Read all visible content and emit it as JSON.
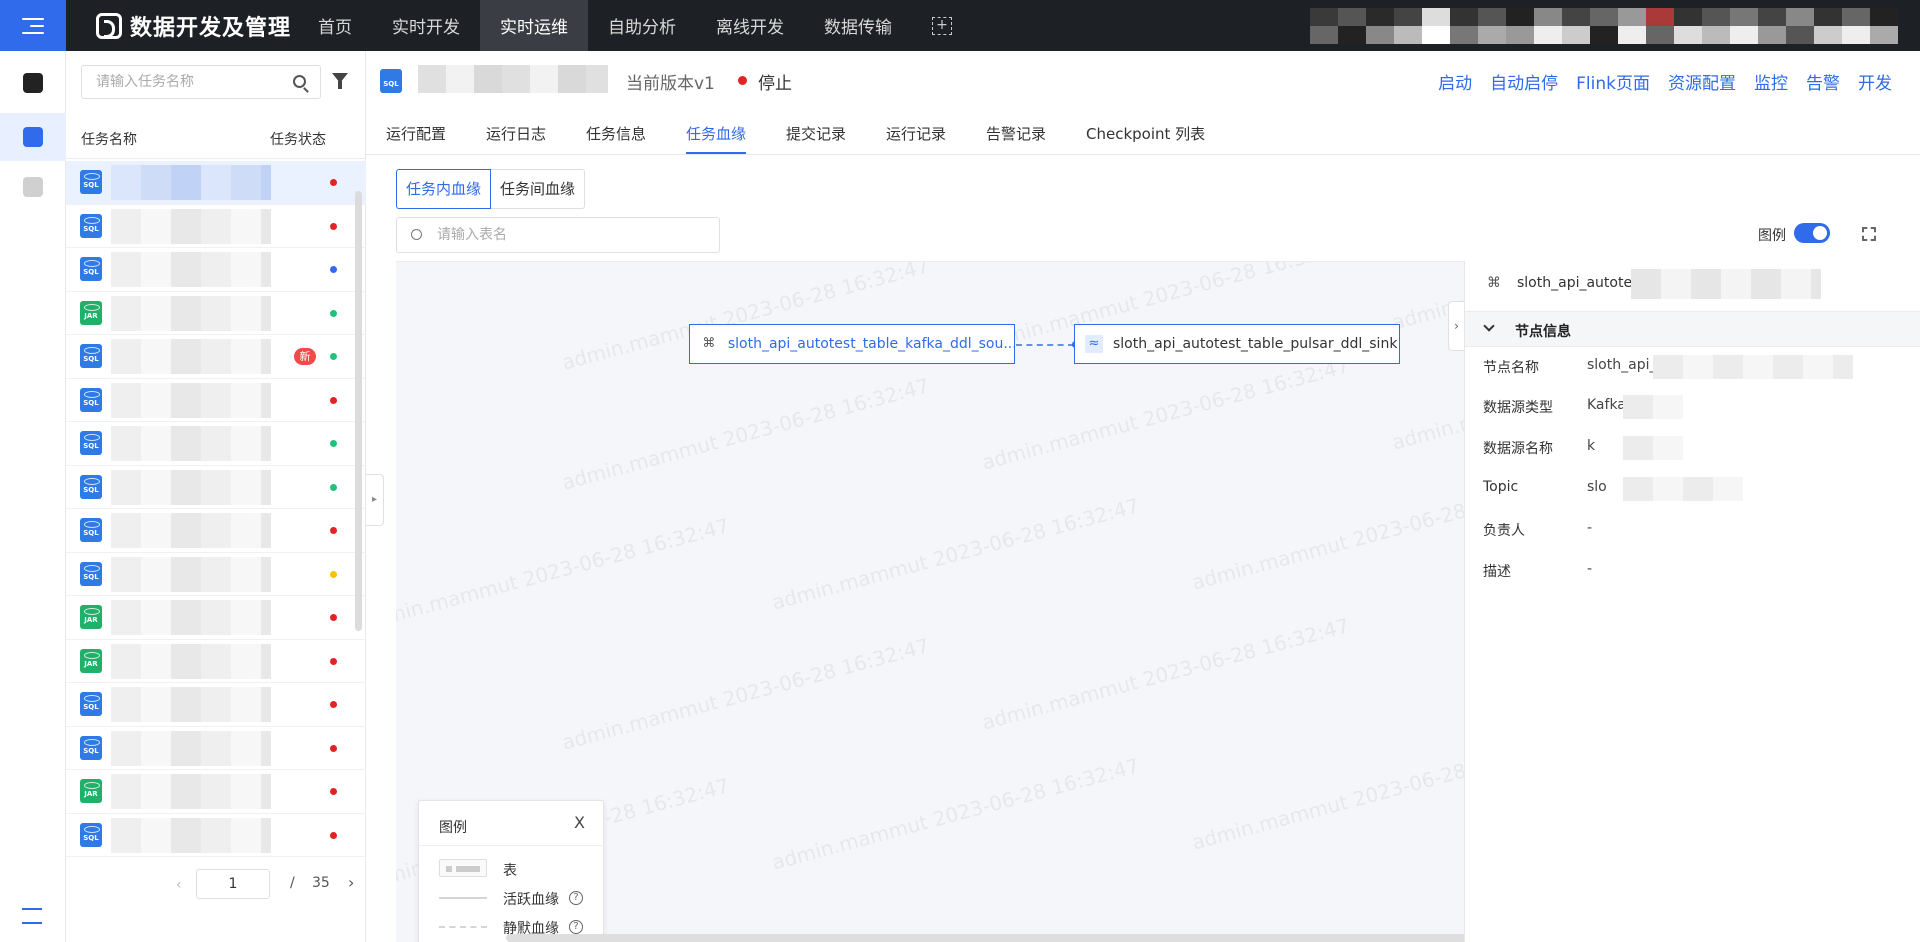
{
  "app": {
    "title": "数据开发及管理"
  },
  "nav": {
    "items": [
      {
        "label": "首页"
      },
      {
        "label": "实时开发"
      },
      {
        "label": "实时运维",
        "active": true
      },
      {
        "label": "自助分析"
      },
      {
        "label": "离线开发"
      },
      {
        "label": "数据传输"
      }
    ]
  },
  "sidebar": {
    "search_placeholder": "请输入任务名称",
    "col_name": "任务名称",
    "col_status": "任务状态",
    "new_tag": "新",
    "rows": [
      {
        "type": "SQL",
        "status": "#e02424",
        "selected": true
      },
      {
        "type": "SQL",
        "status": "#e02424"
      },
      {
        "type": "SQL",
        "status": "#2f6bea"
      },
      {
        "type": "JAR",
        "status": "#22c07a"
      },
      {
        "type": "SQL",
        "status": "#22c07a",
        "new": true
      },
      {
        "type": "SQL",
        "status": "#e02424"
      },
      {
        "type": "SQL",
        "status": "#22c07a"
      },
      {
        "type": "SQL",
        "status": "#22c07a"
      },
      {
        "type": "SQL",
        "status": "#e02424"
      },
      {
        "type": "SQL",
        "status": "#f5c400"
      },
      {
        "type": "JAR",
        "status": "#e02424"
      },
      {
        "type": "JAR",
        "status": "#e02424"
      },
      {
        "type": "SQL",
        "status": "#e02424"
      },
      {
        "type": "SQL",
        "status": "#e02424"
      },
      {
        "type": "JAR",
        "status": "#e02424"
      },
      {
        "type": "SQL",
        "status": "#e02424"
      }
    ],
    "pager": {
      "current": "1",
      "sep": "/",
      "total": "35"
    }
  },
  "task": {
    "type": "SQL",
    "version": "当前版本v1",
    "status": "停止",
    "actions": [
      "启动",
      "自动启停",
      "Flink页面",
      "资源配置",
      "监控",
      "告警",
      "开发"
    ]
  },
  "tabs": [
    {
      "label": "运行配置"
    },
    {
      "label": "运行日志"
    },
    {
      "label": "任务信息"
    },
    {
      "label": "任务血缘",
      "active": true
    },
    {
      "label": "提交记录"
    },
    {
      "label": "运行记录"
    },
    {
      "label": "告警记录"
    },
    {
      "label": "Checkpoint 列表"
    }
  ],
  "lineage": {
    "seg_inner": "任务内血缘",
    "seg_between": "任务间血缘",
    "table_search_placeholder": "请输入表名",
    "legend_label": "图例",
    "source_node": "sloth_api_autotest_table_kafka_ddl_sou...",
    "sink_node": "sloth_api_autotest_table_pulsar_ddl_sink",
    "watermark": "admin.mammut 2023-06-28 16:32:47"
  },
  "legend": {
    "title": "图例",
    "close": "X",
    "table": "表",
    "active": "活跃血缘",
    "silent": "静默血缘"
  },
  "node_info": {
    "title": "sloth_api_autotes",
    "section": "节点信息",
    "fields": [
      {
        "key": "节点名称",
        "value": "sloth_api_"
      },
      {
        "key": "数据源类型",
        "value": "Kafka"
      },
      {
        "key": "数据源名称",
        "value": "k"
      },
      {
        "key": "Topic",
        "value": "slo"
      },
      {
        "key": "负责人",
        "value": "-"
      },
      {
        "key": "描述",
        "value": "-"
      }
    ]
  },
  "colors": {
    "accent": "#2f6bea",
    "topbar": "#1d2025"
  }
}
